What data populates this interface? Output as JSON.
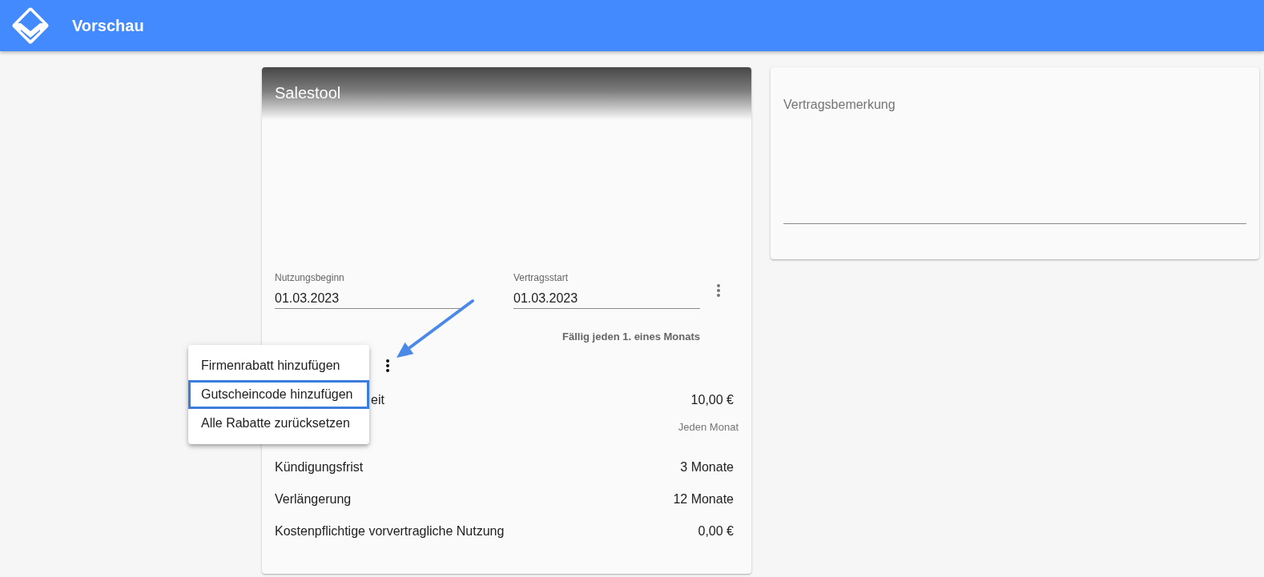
{
  "app_bar": {
    "title": "Vorschau"
  },
  "sales_card": {
    "title": "Salestool",
    "date_fields": [
      {
        "label": "Nutzungsbeginn",
        "value": "01.03.2023"
      },
      {
        "label": "Vertragsstart",
        "value": "01.03.2023"
      }
    ],
    "due_note": "Fällig jeden 1. eines Monats",
    "pricing": {
      "label": "eit",
      "value": "10,00 €",
      "interval": "Jeden Monat"
    },
    "terms": [
      {
        "label": "Kündigungsfrist",
        "value": "3 Monate"
      },
      {
        "label": "Verlängerung",
        "value": "12 Monate"
      },
      {
        "label": "Kostenpflichtige vorvertragliche Nutzung",
        "value": "0,00 €"
      }
    ]
  },
  "discount_menu": {
    "items": [
      {
        "label": "Firmenrabatt hinzufügen",
        "selected": false
      },
      {
        "label": "Gutscheincode hinzufügen",
        "selected": true
      },
      {
        "label": "Alle Rabatte zurücksetzen",
        "selected": false
      }
    ]
  },
  "remark_card": {
    "remark_field": {
      "placeholder": "Vertragsbemerkung"
    }
  }
}
